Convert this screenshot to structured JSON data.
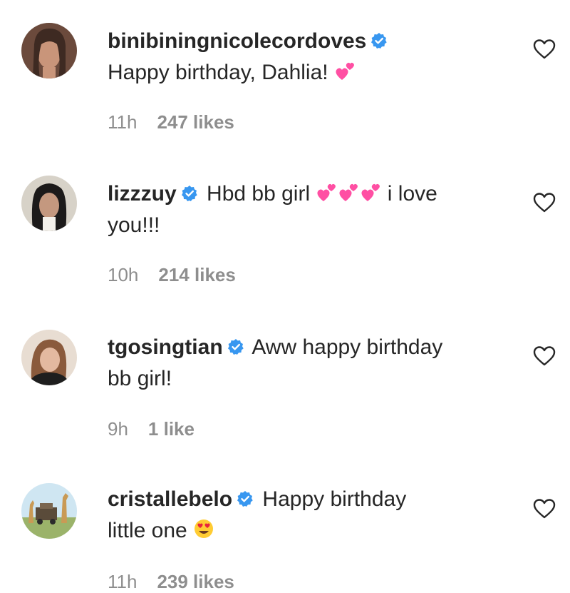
{
  "comments": [
    {
      "username": "binibiningnicolecordoves",
      "verified": true,
      "text_line1": "Happy birthday, Dahlia!",
      "text_line2": "",
      "emoji": "two-hearts-emoji",
      "time": "11h",
      "likes": "247 likes"
    },
    {
      "username": "lizzzuy",
      "verified": true,
      "text_line1": "Hbd bb girl",
      "text_line1_after": "i love",
      "text_line2": "you!!!",
      "emoji": "two-hearts-emoji-x3",
      "time": "10h",
      "likes": "214 likes"
    },
    {
      "username": "tgosingtian",
      "verified": true,
      "text_line1": "Aww happy birthday",
      "text_line2": "bb girl!",
      "time": "9h",
      "likes": "1 like"
    },
    {
      "username": "cristallebelo",
      "verified": true,
      "text_line1": "Happy birthday",
      "text_line2": "little one",
      "emoji": "heart-eyes-emoji",
      "time": "11h",
      "likes": "239 likes"
    }
  ],
  "colors": {
    "text": "#262626",
    "meta": "#8e8e8e",
    "verified_badge": "#3897f0",
    "emoji_heart": "#ff4fa3"
  }
}
